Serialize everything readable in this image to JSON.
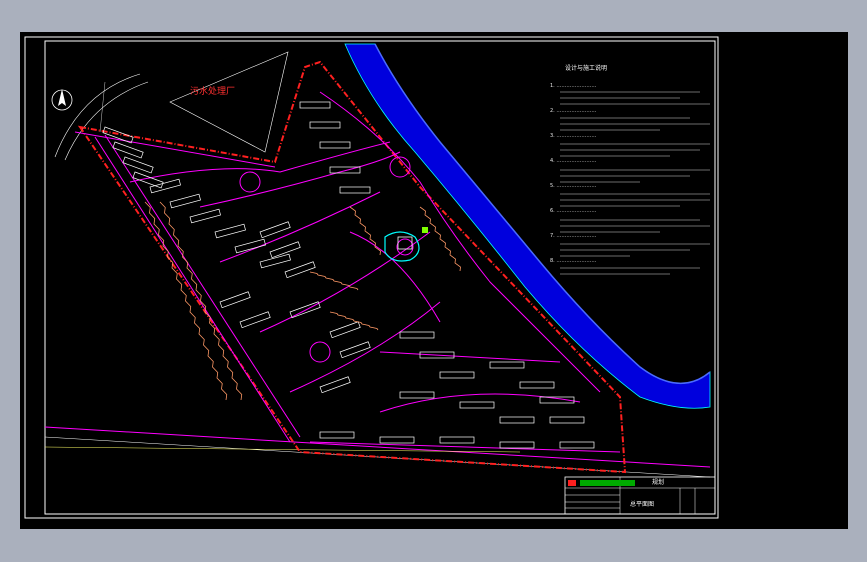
{
  "drawing": {
    "sewage_plant_label": "污水处理厂",
    "notes_heading": "设计与施工说明",
    "notes_lines": [
      "1. ……………………",
      "2. ……………………",
      "3. ……………………",
      "4. ……………………",
      "5. ……………………",
      "6. ……………………",
      "7. ……………………",
      "8. ……………………"
    ],
    "title_block": {
      "project": "规划",
      "drawing_name": "总平面图"
    }
  },
  "colors": {
    "background": "#000000",
    "frame": "#ffffff",
    "roads": "#ff00ff",
    "boundary": "#ff2020",
    "river": "#0000ff",
    "river_edge": "#00ffff",
    "buildings": "#ffffff",
    "villas": "#ff9966",
    "label_red": "#ff3030"
  }
}
